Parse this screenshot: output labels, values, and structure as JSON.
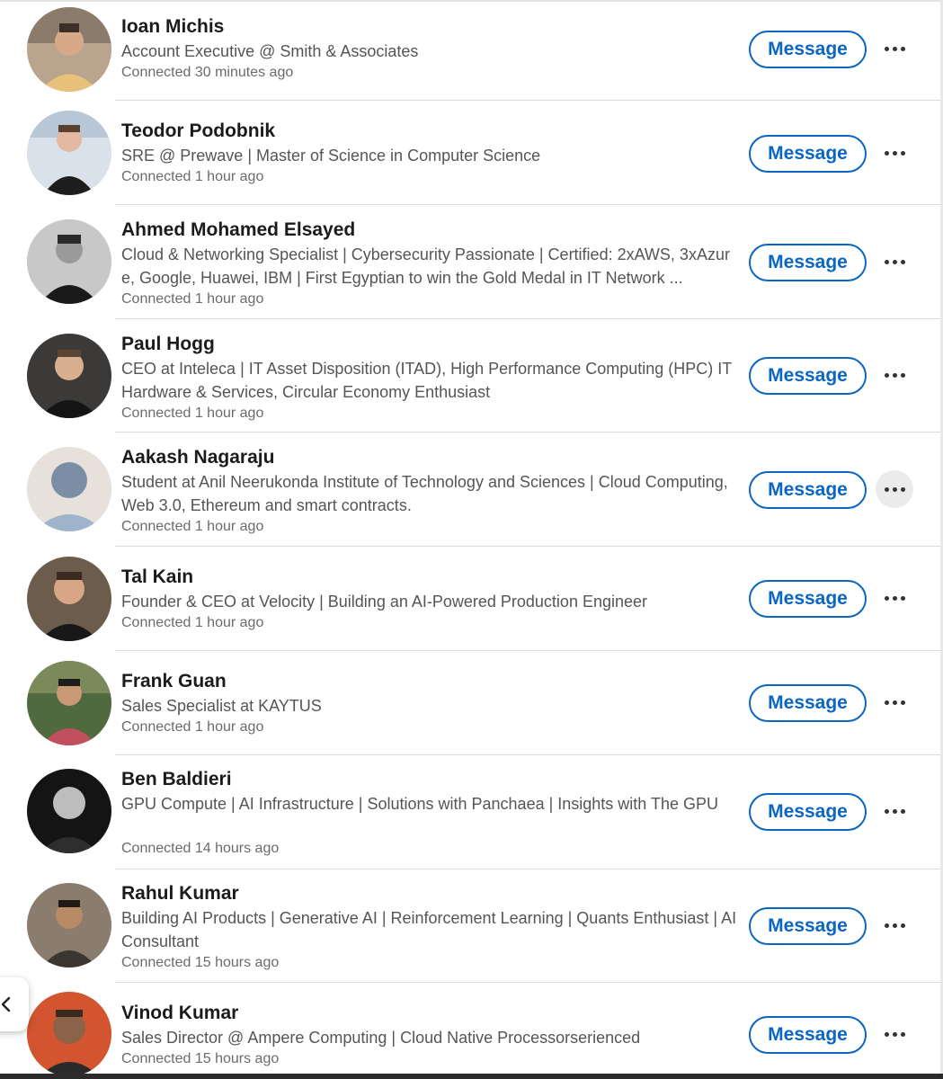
{
  "action_label": "Message",
  "connections": [
    {
      "name": "Ioan Michis",
      "headline": "Account Executive @ Smith & Associates",
      "time": "Connected 30 minutes ago"
    },
    {
      "name": "Teodor Podobnik",
      "headline": "SRE @ Prewave | Master of Science in Computer Science",
      "time": "Connected 1 hour ago"
    },
    {
      "name": "Ahmed Mohamed Elsayed",
      "headline": "Cloud & Networking Specialist | Cybersecurity Passionate | Certified: 2xAWS, 3xAzure, Google, Huawei, IBM | First Egyptian to win the Gold Medal in IT Network ...",
      "time": "Connected 1 hour ago"
    },
    {
      "name": "Paul Hogg",
      "headline": "CEO at Inteleca | IT Asset Disposition (ITAD), High Performance Computing (HPC) IT Hardware & Services, Circular Economy Enthusiast",
      "time": "Connected 1 hour ago"
    },
    {
      "name": "Aakash Nagaraju",
      "headline": "Student at Anil Neerukonda Institute of Technology and Sciences | Cloud Computing, Web 3.0, Ethereum and smart contracts.",
      "time": "Connected 1 hour ago"
    },
    {
      "name": "Tal Kain",
      "headline": "Founder & CEO at Velocity | Building an AI-Powered Production Engineer",
      "time": "Connected 1 hour ago"
    },
    {
      "name": "Frank Guan",
      "headline": "Sales Specialist at KAYTUS",
      "time": "Connected 1 hour ago"
    },
    {
      "name": "Ben Baldieri",
      "headline": "GPU Compute | AI Infrastructure | Solutions with Panchaea | Insights with The GPU",
      "time": "Connected 14 hours ago"
    },
    {
      "name": "Rahul Kumar",
      "headline": "Building AI Products | Generative AI | Reinforcement Learning | Quants Enthusiast | AI Consultant",
      "time": "Connected 15 hours ago"
    },
    {
      "name": "Vinod Kumar",
      "headline": "Sales Director @ Ampere Computing | Cloud Native Processorserienced",
      "time": "Connected 15 hours ago"
    }
  ],
  "colors": {
    "accent": "#0a66c2",
    "divider": "#dcdcdc",
    "secondary_text": "#555555"
  },
  "icons": {
    "more": "more-horizontal-icon",
    "back": "chevron-left-icon"
  }
}
